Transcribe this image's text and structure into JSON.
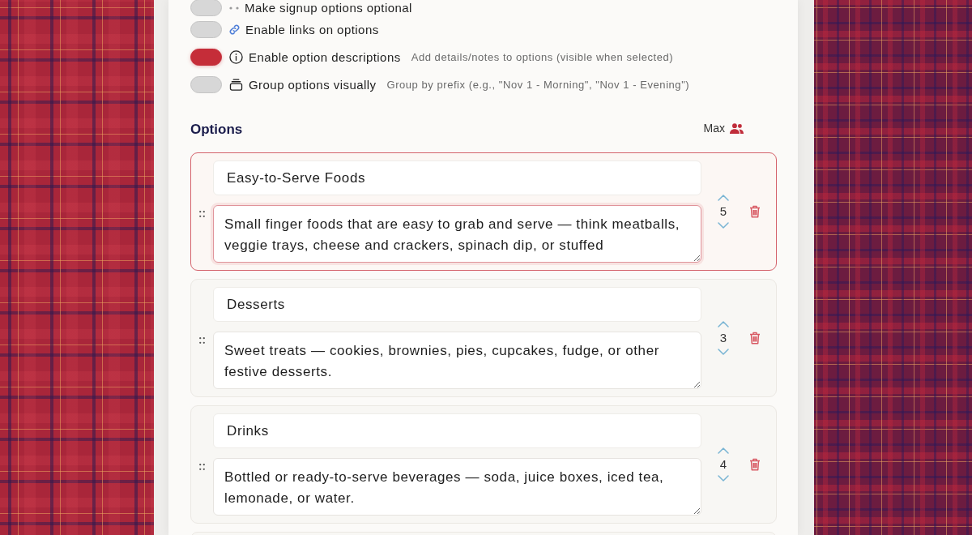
{
  "settings": [
    {
      "label": "Make signup options optional",
      "on": false
    },
    {
      "label": "Enable links on options",
      "on": false
    },
    {
      "label": "Enable option descriptions",
      "hint": "Add details/notes to options (visible when selected)",
      "on": true
    },
    {
      "label": "Group options visually",
      "hint": "Group by prefix (e.g., \"Nov 1 - Morning\", \"Nov 1 - Evening\")",
      "on": false
    }
  ],
  "options_section": {
    "title": "Options",
    "max_label": "Max"
  },
  "options": [
    {
      "name": "Easy-to-Serve Foods",
      "description": "Small finger foods that are easy to grab and serve — think meatballs, veggie trays, cheese and crackers, spinach dip, or stuffed",
      "max": "5",
      "focused": true
    },
    {
      "name": "Desserts",
      "description": "Sweet treats — cookies, brownies, pies, cupcakes, fudge, or other festive desserts.",
      "max": "3",
      "focused": false
    },
    {
      "name": "Drinks",
      "description": "Bottled or ready-to-serve beverages — soda, juice boxes, iced tea, lemonade, or water.",
      "max": "4",
      "focused": false
    }
  ]
}
